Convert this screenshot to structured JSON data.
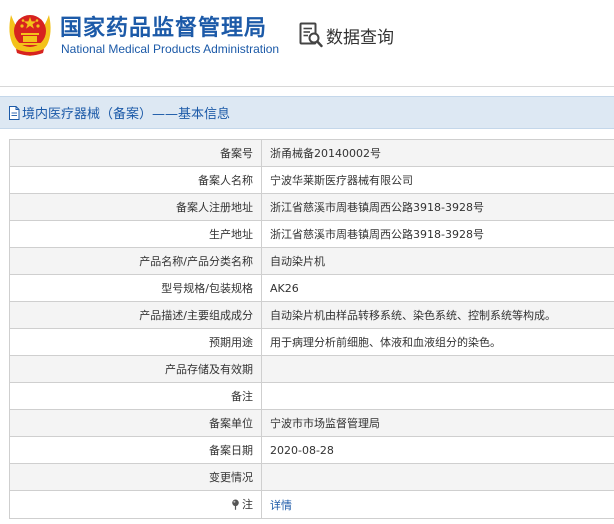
{
  "header": {
    "org_name_cn": "国家药品监督管理局",
    "org_name_en": "National Medical Products Administration",
    "query_label": "数据查询"
  },
  "section": {
    "title": "境内医疗器械（备案）——基本信息"
  },
  "record": {
    "rows": [
      {
        "label": "备案号",
        "value": "浙甬械备20140002号"
      },
      {
        "label": "备案人名称",
        "value": "宁波华莱斯医疗器械有限公司"
      },
      {
        "label": "备案人注册地址",
        "value": "浙江省慈溪市周巷镇周西公路3918-3928号"
      },
      {
        "label": "生产地址",
        "value": "浙江省慈溪市周巷镇周西公路3918-3928号"
      },
      {
        "label": "产品名称/产品分类名称",
        "value": "自动染片机"
      },
      {
        "label": "型号规格/包装规格",
        "value": "AK26"
      },
      {
        "label": "产品描述/主要组成成分",
        "value": "自动染片机由样品转移系统、染色系统、控制系统等构成。"
      },
      {
        "label": "预期用途",
        "value": "用于病理分析前细胞、体液和血液组分的染色。"
      },
      {
        "label": "产品存储及有效期",
        "value": ""
      },
      {
        "label": "备注",
        "value": ""
      },
      {
        "label": "备案单位",
        "value": "宁波市市场监督管理局"
      },
      {
        "label": "备案日期",
        "value": "2020-08-28"
      },
      {
        "label": "变更情况",
        "value": ""
      }
    ],
    "note": {
      "label": "注",
      "link_text": "详情"
    }
  },
  "colors": {
    "brand_blue": "#1c5aa8",
    "emblem_red": "#d7231f",
    "emblem_gold": "#f3c21a",
    "section_bg": "#dde8f3"
  },
  "icons": [
    "national-emblem-icon",
    "search-document-icon",
    "document-icon",
    "pin-icon"
  ]
}
